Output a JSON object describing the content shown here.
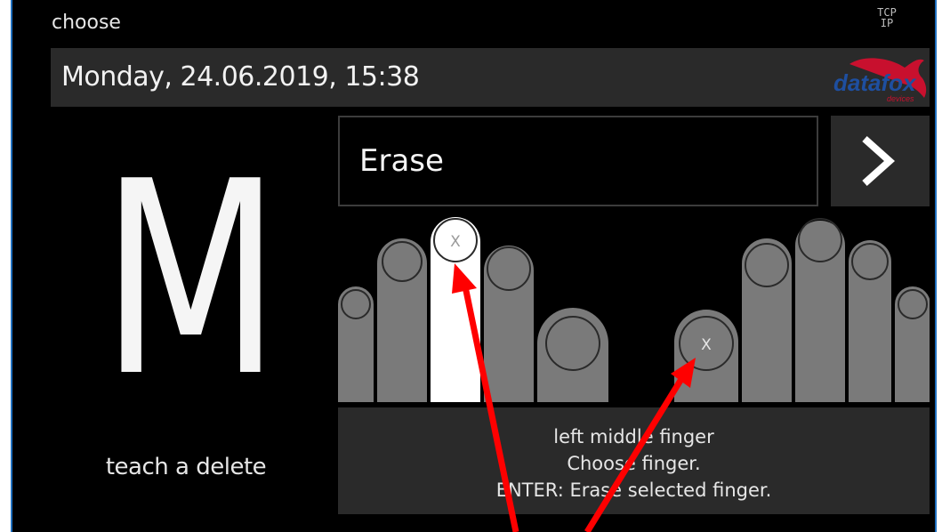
{
  "header": {
    "mode_label": "choose",
    "connection_indicator": "TCP IP",
    "datetime": "Monday, 24.06.2019, 15:38",
    "logo_text": "datafox",
    "logo_subtext": "devices"
  },
  "mode": {
    "letter": "M",
    "caption": "teach a delete"
  },
  "action": {
    "label": "Erase",
    "next_icon": "chevron-right-icon"
  },
  "fingers": {
    "left_hand": [
      "little",
      "ring",
      "middle",
      "index",
      "thumb"
    ],
    "right_hand": [
      "thumb",
      "index",
      "middle",
      "ring",
      "little"
    ],
    "selected": "left middle",
    "enrolled_marker": "X",
    "enrolled": [
      "left middle",
      "right thumb"
    ]
  },
  "info": {
    "line1": "left middle finger",
    "line2": "Choose finger.",
    "line3": "ENTER: Erase selected finger."
  },
  "colors": {
    "background": "#000000",
    "panel": "#2a2a2a",
    "finger": "#7a7a7a",
    "finger_selected": "#ffffff",
    "brand": "#c8102e",
    "brand_blue": "#1e4fa0",
    "annotation_arrow": "#ff0000"
  }
}
